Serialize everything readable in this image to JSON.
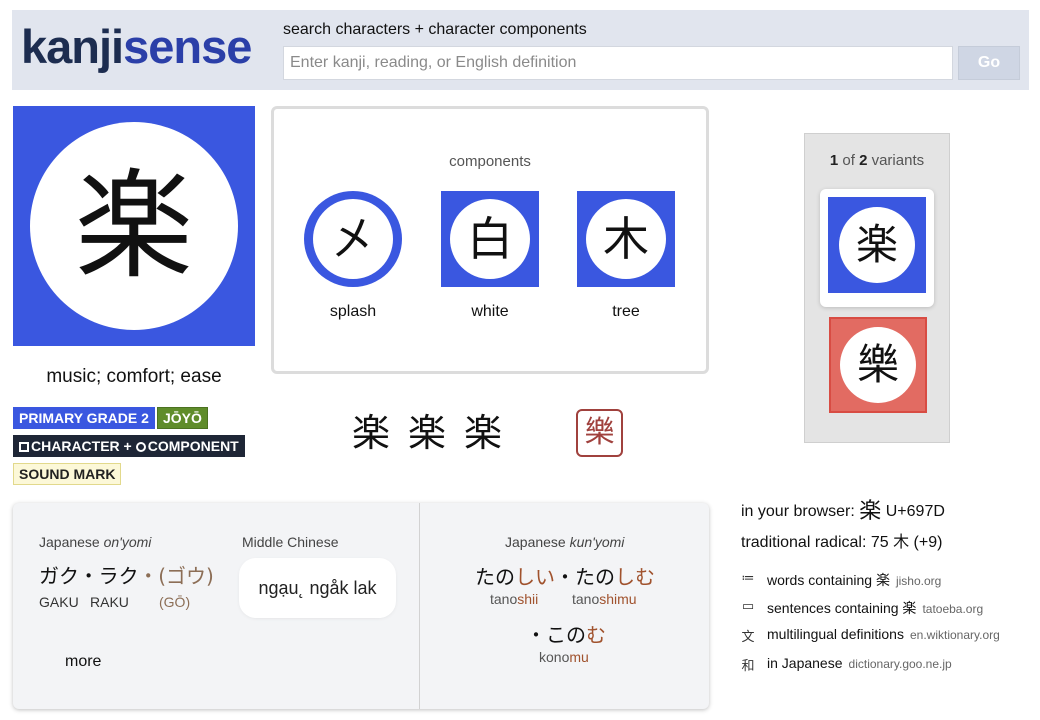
{
  "header": {
    "logo_part1": "kanji",
    "logo_part2": "sense",
    "search_label": "search characters + character components",
    "search_placeholder": "Enter kanji, reading, or English definition",
    "go_label": "Go"
  },
  "kanji": {
    "character": "楽",
    "meaning": "music; comfort; ease"
  },
  "badges": {
    "grade": "PRIMARY GRADE 2",
    "joyo": "JŌYŌ",
    "character_label": "CHARACTER +",
    "component_label": "COMPONENT",
    "sound_mark": "SOUND MARK"
  },
  "components": {
    "title": "components",
    "items": [
      {
        "char": "㐅",
        "label": "splash"
      },
      {
        "char": "白",
        "label": "white"
      },
      {
        "char": "木",
        "label": "tree"
      }
    ]
  },
  "forms": {
    "glyphs": "楽楽楽",
    "seal": "樂"
  },
  "variants": {
    "current": "1",
    "of_text": "of",
    "total": "2",
    "suffix": "variants",
    "items": [
      {
        "char": "楽",
        "color": "#3a57e0"
      },
      {
        "char": "樂",
        "color": "#e26b62"
      }
    ]
  },
  "info": {
    "browser_label": "in your browser:",
    "browser_char": "楽",
    "codepoint": "U+697D",
    "radical_text": "traditional radical: 75 木  (+9)"
  },
  "links": [
    {
      "icon": "list-icon",
      "glyph": "≔",
      "label": "words containing 楽",
      "domain": "jisho.org"
    },
    {
      "icon": "speech-bubble-icon",
      "glyph": "▭",
      "label": "sentences containing 楽",
      "domain": "tatoeba.org"
    },
    {
      "icon": "translate-icon",
      "glyph": "文",
      "label": "multilingual definitions",
      "domain": "en.wiktionary.org"
    },
    {
      "icon": "japanese-icon",
      "glyph": "和",
      "label": "in Japanese",
      "domain": "dictionary.goo.ne.jp"
    }
  ],
  "readings": {
    "onyomi_title_prefix": "Japanese ",
    "onyomi_title_em": "on'yomi",
    "onyomi_kana_main": "ガク・ラク",
    "onyomi_kana_extra": "・(ゴウ)",
    "onyomi_romaji_1": "GAKU",
    "onyomi_romaji_2": "RAKU",
    "onyomi_romaji_extra": "(GŌ)",
    "mc_title": "Middle Chinese",
    "mc_value": "ngạu˛ ngåk lak",
    "kunyomi_title_prefix": "Japanese ",
    "kunyomi_title_em": "kun'yomi",
    "kun1_stem": "たの",
    "kun1_okurigana": "しい",
    "kun_sep": "・",
    "kun2_stem": "たの",
    "kun2_okurigana": "しむ",
    "kun1_romaji_stem": "tano",
    "kun1_romaji_ok": "shii",
    "kun2_romaji_stem": "tano",
    "kun2_romaji_ok": "shimu",
    "kun3_prefix": "・",
    "kun3_stem": "この",
    "kun3_okurigana": "む",
    "kun3_romaji_stem": "kono",
    "kun3_romaji_ok": "mu",
    "more_label": "more"
  }
}
